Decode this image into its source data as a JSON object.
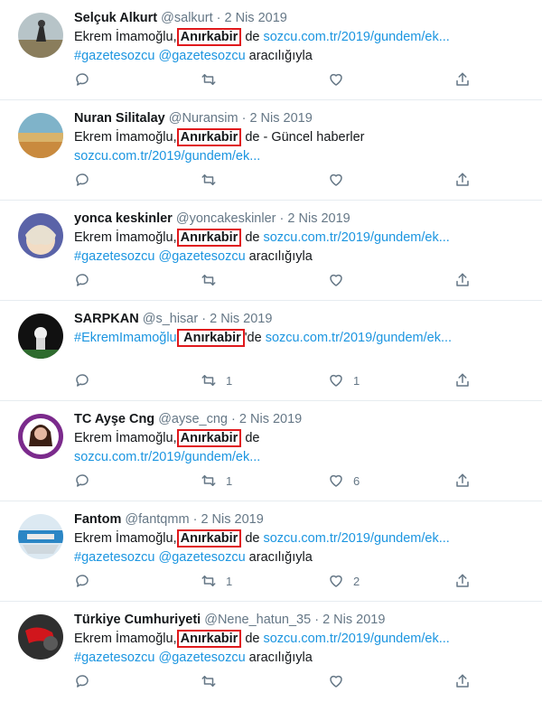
{
  "icons": {
    "reply": "reply-icon",
    "retweet": "retweet-icon",
    "like": "heart-icon",
    "share": "share-icon"
  },
  "colors": {
    "link": "#1b95e0",
    "muted": "#657786",
    "highlight_border": "#e0191c"
  },
  "tweets": [
    {
      "name": "Selçuk Alkurt",
      "handle": "@salkurt",
      "date": "2 Nis 2019",
      "line1": {
        "prefix": "Ekrem İmamoğlu,",
        "highlight": "Anırkabir",
        "suffix": " de ",
        "link": "sozcu.com.tr/2019/gundem/ek..."
      },
      "line2": {
        "hashtag": "#gazetesozcu",
        "mention": "@gazetesozcu",
        "tail": " aracılığıyla"
      },
      "retweets": "",
      "likes": ""
    },
    {
      "name": "Nuran Silitalay",
      "handle": "@Nuransim",
      "date": "2 Nis 2019",
      "line1": {
        "prefix": "Ekrem İmamoğlu,",
        "highlight": "Anırkabir",
        "suffix": " de - Güncel haberler",
        "link": ""
      },
      "line2": {
        "link": "sozcu.com.tr/2019/gundem/ek..."
      },
      "retweets": "",
      "likes": ""
    },
    {
      "name": "yonca keskinler",
      "handle": "@yoncakeskinler",
      "date": "2 Nis 2019",
      "line1": {
        "prefix": "Ekrem İmamoğlu,",
        "highlight": "Anırkabir",
        "suffix": " de ",
        "link": "sozcu.com.tr/2019/gundem/ek..."
      },
      "line2": {
        "hashtag": "#gazetesozcu",
        "mention": "@gazetesozcu",
        "tail": " aracılığıyla"
      },
      "retweets": "",
      "likes": ""
    },
    {
      "name": "SARPKAN",
      "handle": "@s_hisar",
      "date": "2 Nis 2019",
      "line1": {
        "hashtag": "#EkremImamoğlu",
        "highlight": " Anırkabir",
        "suffix": "'de ",
        "link": "sozcu.com.tr/2019/gundem/ek..."
      },
      "retweets": "1",
      "likes": "1"
    },
    {
      "name": "TC Ayşe Cng",
      "handle": "@ayse_cng",
      "date": "2 Nis 2019",
      "line1": {
        "prefix": "Ekrem İmamoğlu,",
        "highlight": "Anırkabir",
        "suffix": " de",
        "link": ""
      },
      "line2": {
        "link": "sozcu.com.tr/2019/gundem/ek..."
      },
      "retweets": "1",
      "likes": "6"
    },
    {
      "name": "Fantom",
      "handle": "@fantqmm",
      "date": "2 Nis 2019",
      "line1": {
        "prefix": "Ekrem İmamoğlu,",
        "highlight": "Anırkabir",
        "suffix": " de ",
        "link": "sozcu.com.tr/2019/gundem/ek..."
      },
      "line2": {
        "hashtag": "#gazetesozcu",
        "mention": "@gazetesozcu",
        "tail": " aracılığıyla"
      },
      "retweets": "1",
      "likes": "2"
    },
    {
      "name": "Türkiye Cumhuriyeti",
      "handle": "@Nene_hatun_35",
      "date": "2 Nis 2019",
      "line1": {
        "prefix": "Ekrem İmamoğlu,",
        "highlight": "Anırkabir",
        "suffix": " de ",
        "link": "sozcu.com.tr/2019/gundem/ek..."
      },
      "line2": {
        "hashtag": "#gazetesozcu",
        "mention": "@gazetesozcu",
        "tail": " aracılığıyla"
      },
      "retweets": "",
      "likes": ""
    }
  ]
}
